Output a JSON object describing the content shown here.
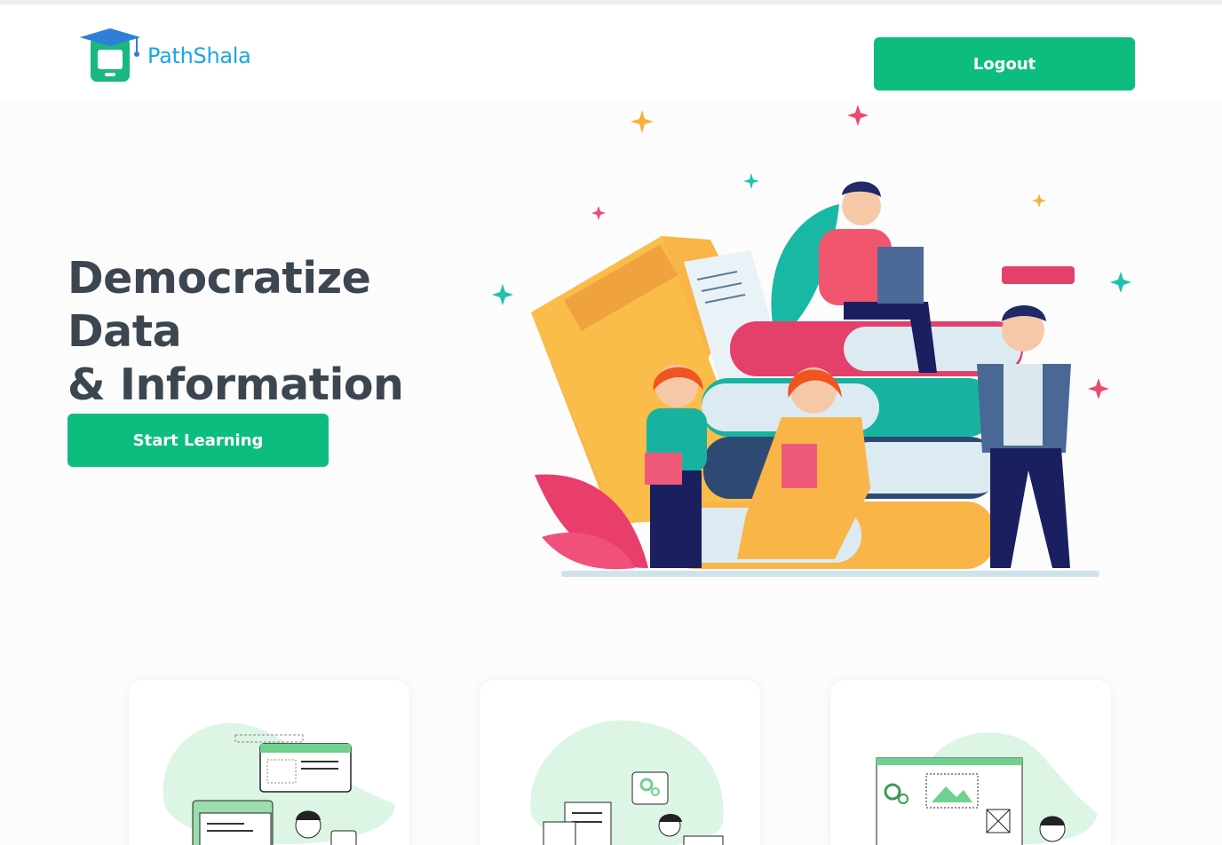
{
  "header": {
    "brand": "PathShala",
    "logout_label": "Logout"
  },
  "hero": {
    "title_line1": "Democratize Data",
    "title_line2": "& Information",
    "cta_label": "Start Learning",
    "illustration": "students-with-books-illustration"
  },
  "cards": [
    {
      "illustration": "web-developer-illustration"
    },
    {
      "illustration": "documents-settings-illustration"
    },
    {
      "illustration": "design-wireframe-illustration"
    }
  ],
  "colors": {
    "accent": "#0dbd7d",
    "brand_blue": "#1aa6e8",
    "title": "#3c4650"
  }
}
